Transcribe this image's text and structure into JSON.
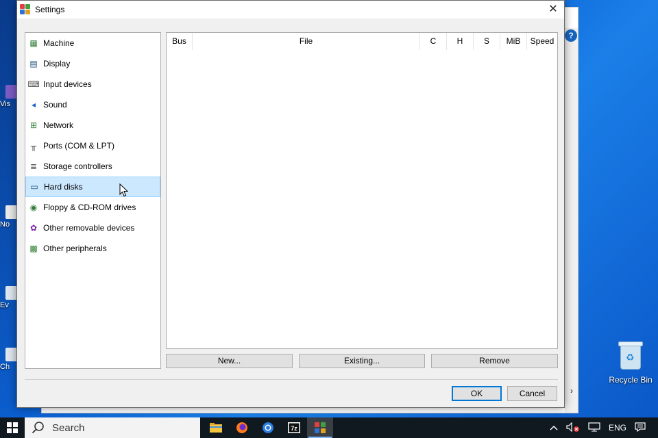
{
  "dialog": {
    "title": "Settings",
    "close_glyph": "✕"
  },
  "sidebar": {
    "items": [
      {
        "label": "Machine",
        "icon": "machine-icon",
        "glyph": "▦",
        "color": "#2e7d32"
      },
      {
        "label": "Display",
        "icon": "display-icon",
        "glyph": "▤",
        "color": "#1f4e79"
      },
      {
        "label": "Input devices",
        "icon": "input-devices-icon",
        "glyph": "⌨",
        "color": "#555555"
      },
      {
        "label": "Sound",
        "icon": "sound-icon",
        "glyph": "◂",
        "color": "#1565c0"
      },
      {
        "label": "Network",
        "icon": "network-icon",
        "glyph": "⊞",
        "color": "#2e7d32"
      },
      {
        "label": "Ports (COM & LPT)",
        "icon": "ports-icon",
        "glyph": "╥",
        "color": "#444444"
      },
      {
        "label": "Storage controllers",
        "icon": "storage-controllers-icon",
        "glyph": "≣",
        "color": "#555555"
      },
      {
        "label": "Hard disks",
        "icon": "hard-disks-icon",
        "glyph": "▭",
        "color": "#1f4e79"
      },
      {
        "label": "Floppy & CD-ROM drives",
        "icon": "floppy-cdrom-icon",
        "glyph": "◉",
        "color": "#2e7d32"
      },
      {
        "label": "Other removable devices",
        "icon": "removable-devices-icon",
        "glyph": "✿",
        "color": "#7b1fa2"
      },
      {
        "label": "Other peripherals",
        "icon": "peripherals-icon",
        "glyph": "▩",
        "color": "#2e7d32"
      }
    ],
    "selected": "Hard disks"
  },
  "table": {
    "columns": [
      {
        "label": "Bus"
      },
      {
        "label": "File"
      },
      {
        "label": "C"
      },
      {
        "label": "H"
      },
      {
        "label": "S"
      },
      {
        "label": "MiB"
      },
      {
        "label": "Speed"
      }
    ],
    "rows": []
  },
  "buttons": {
    "new": "New...",
    "existing": "Existing...",
    "remove": "Remove",
    "ok": "OK",
    "cancel": "Cancel"
  },
  "desktop": {
    "recycle_bin": "Recycle Bin",
    "partial_labels": [
      "Vis",
      "No",
      "Ev",
      "Ch"
    ]
  },
  "taskbar": {
    "search_placeholder": "Search",
    "language": "ENG",
    "apps": [
      "file-explorer-icon",
      "firefox-icon",
      "chrome-icon",
      "7zip-icon",
      "virtualbox-icon"
    ],
    "active_app": "virtualbox-icon"
  },
  "colors": {
    "selection_bg": "#cce8ff",
    "selection_border": "#99d1ff",
    "accent": "#0078d7",
    "taskbar": "#101820"
  }
}
